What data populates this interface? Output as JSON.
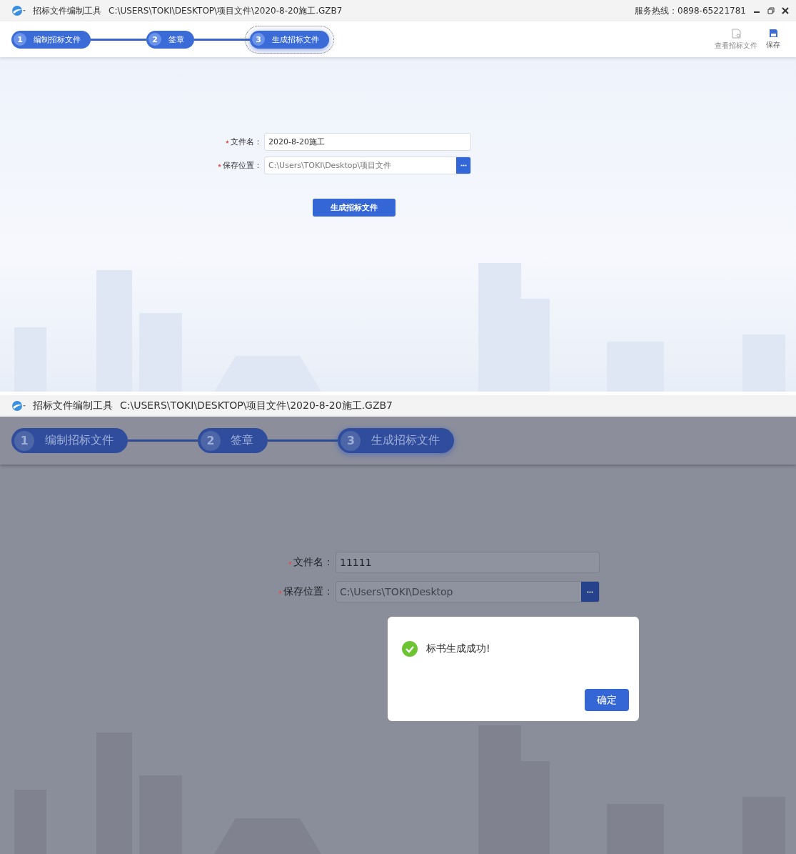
{
  "screens": [
    {
      "app_name": "招标文件编制工具",
      "file_path": "C:\\USERS\\TOKI\\DESKTOP\\项目文件\\2020-8-20施工.GZB7",
      "hotline": "服务热线：0898-65221781",
      "window_controls": true,
      "modal_open": false,
      "steps": [
        {
          "number": "1",
          "label": "编制招标文件",
          "selected": false
        },
        {
          "number": "2",
          "label": "签章",
          "selected": false
        },
        {
          "number": "3",
          "label": "生成招标文件",
          "selected": true
        }
      ],
      "toolbar": [
        {
          "kind": "view",
          "label": "查看招标文件",
          "disabled": true
        },
        {
          "kind": "save",
          "label": "保存",
          "disabled": false
        }
      ],
      "fields": [
        {
          "kind": "text",
          "label": "文件名：",
          "value": "2020-8-20施工",
          "required": true
        },
        {
          "kind": "browse",
          "label": "保存位置：",
          "value": "C:\\Users\\TOKI\\Desktop\\项目文件",
          "required": true
        }
      ],
      "generate_button": "生成招标文件"
    },
    {
      "app_name": "招标文件编制工具",
      "file_path": "C:\\USERS\\TOKI\\DESKTOP\\项目文件\\2020-8-20施工.GZB7",
      "window_controls": false,
      "modal_open": true,
      "steps": [
        {
          "number": "1",
          "label": "编制招标文件",
          "selected": false
        },
        {
          "number": "2",
          "label": "签章",
          "selected": false
        },
        {
          "number": "3",
          "label": "生成招标文件",
          "selected": true
        }
      ],
      "fields": [
        {
          "kind": "text",
          "label": "文件名：",
          "value": "11111",
          "required": true
        },
        {
          "kind": "browse",
          "label": "保存位置：",
          "value": "C:\\Users\\TOKI\\Desktop",
          "required": true
        }
      ],
      "dialog": {
        "message": "标书生成成功!",
        "ok_button": "确定"
      }
    }
  ]
}
